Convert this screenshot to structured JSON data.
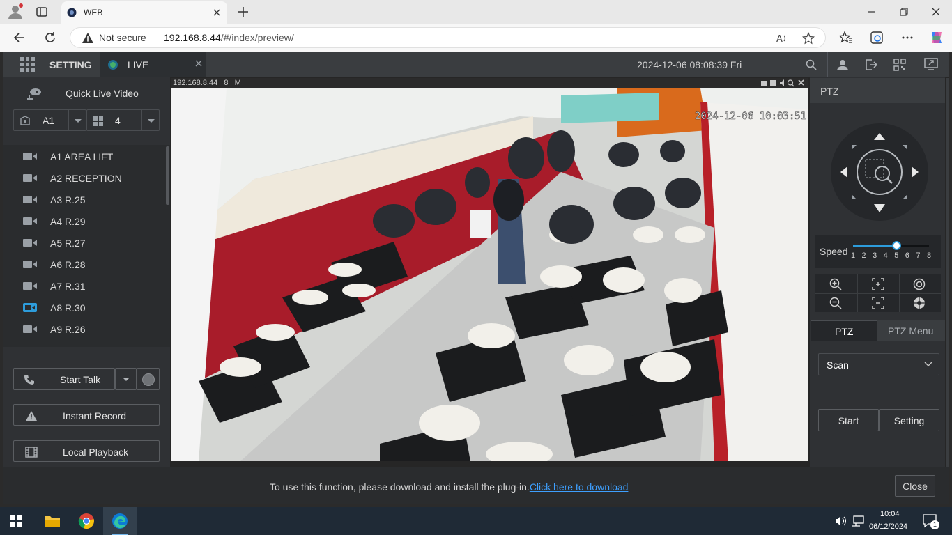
{
  "browser": {
    "tab_title": "WEB",
    "security_label": "Not secure",
    "url_host": "192.168.8.44",
    "url_path": "/#/index/preview/"
  },
  "app": {
    "setting_label": "SETTING",
    "live_label": "LIVE",
    "datetime": "2024-12-06 08:08:39 Fri"
  },
  "left": {
    "quick_live": "Quick Live Video",
    "group_select": "A1",
    "layout_select": "4",
    "cameras": [
      "A1 AREA LIFT",
      "A2 RECEPTION",
      "A3 R.25",
      "A4 R.29",
      "A5 R.27",
      "A6 R.28",
      "A7 R.31",
      "A8 R.30",
      "A9 R.26"
    ],
    "active_camera_index": 7,
    "start_talk": "Start Talk",
    "instant_record": "Instant Record",
    "local_playback": "Local Playback"
  },
  "video": {
    "info": "192.168.8.44   8   M",
    "osd_time": "2024-12-06  10:03:51"
  },
  "ptz": {
    "header": "PTZ",
    "speed_label": "Speed",
    "speed_ticks": [
      "1",
      "2",
      "3",
      "4",
      "5",
      "6",
      "7",
      "8"
    ],
    "speed_value": 5,
    "tab_ptz": "PTZ",
    "tab_menu": "PTZ Menu",
    "mode_value": "Scan",
    "start_label": "Start",
    "setting_label": "Setting"
  },
  "notice": {
    "text": "To use this function, please download and install the plug-in.",
    "link": "Click here to download",
    "close": "Close"
  },
  "taskbar": {
    "time": "10:04",
    "date": "06/12/2024",
    "notif_count": "1"
  },
  "colors": {
    "accent": "#2d9cdb",
    "link": "#3ea0ff",
    "active_cam": "#2d9cdb"
  }
}
